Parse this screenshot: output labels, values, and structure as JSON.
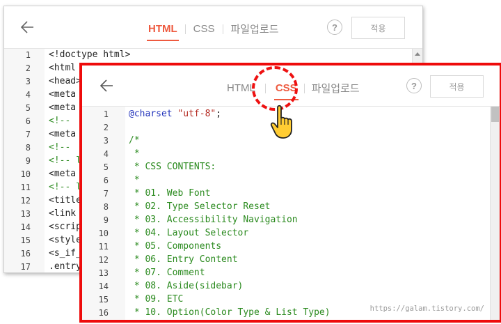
{
  "back_panel": {
    "tabs": [
      {
        "label": "HTML",
        "active": true
      },
      {
        "label": "CSS",
        "active": false
      },
      {
        "label": "파일업로드",
        "active": false
      }
    ],
    "help_label": "?",
    "apply_label": "적용",
    "line_numbers": [
      "1",
      "2",
      "3",
      "4",
      "5",
      "6",
      "7",
      "8",
      "9",
      "10",
      "11",
      "12",
      "13",
      "14",
      "15",
      "16",
      "17"
    ],
    "code_lines": [
      "<!doctype html>",
      "<html",
      "<head>",
      "<meta",
      "<meta",
      "<!-- ",
      "<meta",
      "<!-- ",
      "<!-- l",
      "<meta",
      "<!-- l",
      "<title",
      "<link",
      "<scrip",
      "<style",
      "<s_if_",
      ".entry"
    ]
  },
  "front_panel": {
    "tabs": [
      {
        "label": "HTML",
        "active": false
      },
      {
        "label": "CSS",
        "active": true
      },
      {
        "label": "파일업로드",
        "active": false
      }
    ],
    "help_label": "?",
    "apply_label": "적용",
    "line_numbers": [
      "1",
      "2",
      "3",
      "4",
      "5",
      "6",
      "7",
      "8",
      "9",
      "10",
      "11",
      "12",
      "13",
      "14",
      "15",
      "16"
    ],
    "code": {
      "charset_keyword": "@charset",
      "charset_value": "\"utf-8\"",
      "charset_end": ";",
      "comment_lines": [
        "/*",
        " *",
        " * CSS CONTENTS:",
        " *",
        " * 01. Web Font",
        " * 02. Type Selector Reset",
        " * 03. Accessibility Navigation",
        " * 04. Layout Selector",
        " * 05. Components",
        " * 06. Entry Content",
        " * 07. Comment",
        " * 08. Aside(sidebar)",
        " * 09. ETC",
        " * 10. Option(Color Type & List Type)"
      ]
    }
  },
  "watermark": "https://galam.tistory.com/",
  "colors": {
    "highlight_border": "#ee0b0b",
    "active_tab": "#ee5a3f",
    "comment": "#2a8a1e",
    "keyword": "#2233bb",
    "string": "#b3281f"
  },
  "icons": [
    "back-arrow-icon",
    "help-icon",
    "pointing-hand-icon",
    "scroll-up-icon"
  ]
}
